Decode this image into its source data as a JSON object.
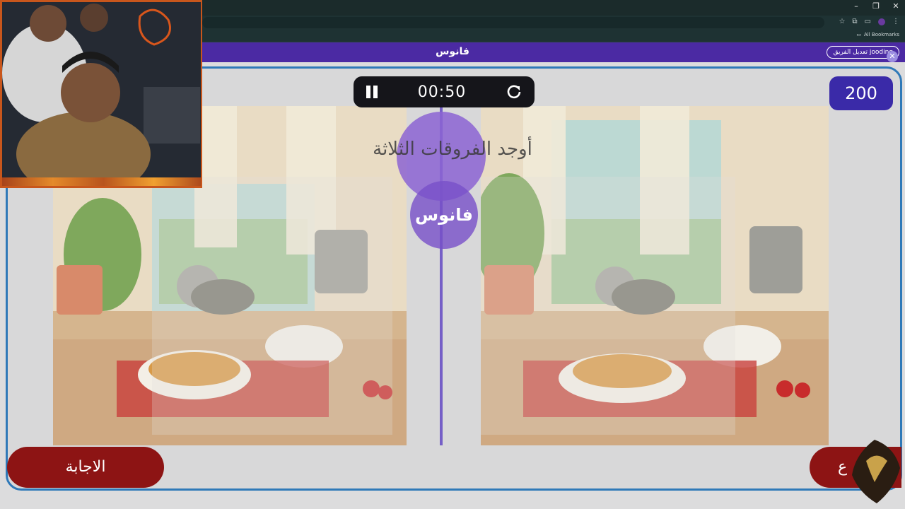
{
  "browser": {
    "bookmarks_label": "All Bookmarks"
  },
  "app": {
    "title": "فانوس",
    "team_pill": "تعديل الفريق jooding",
    "close_icon": "close-icon"
  },
  "timer": {
    "time": "00:50",
    "pause_icon": "pause-icon",
    "reset_icon": "refresh-icon"
  },
  "score": "200",
  "logo": {
    "text": "فانوس"
  },
  "instruction": "أوجد الفروقات الثلاثة",
  "buttons": {
    "answer": "الاجابة",
    "right_partial": "ع"
  },
  "colors": {
    "app_bar": "#4b2aa3",
    "frame_border": "#2f79b8",
    "answer_button": "#8d1414",
    "score_badge": "#3a2aa8",
    "timer_bg": "#15151a"
  }
}
